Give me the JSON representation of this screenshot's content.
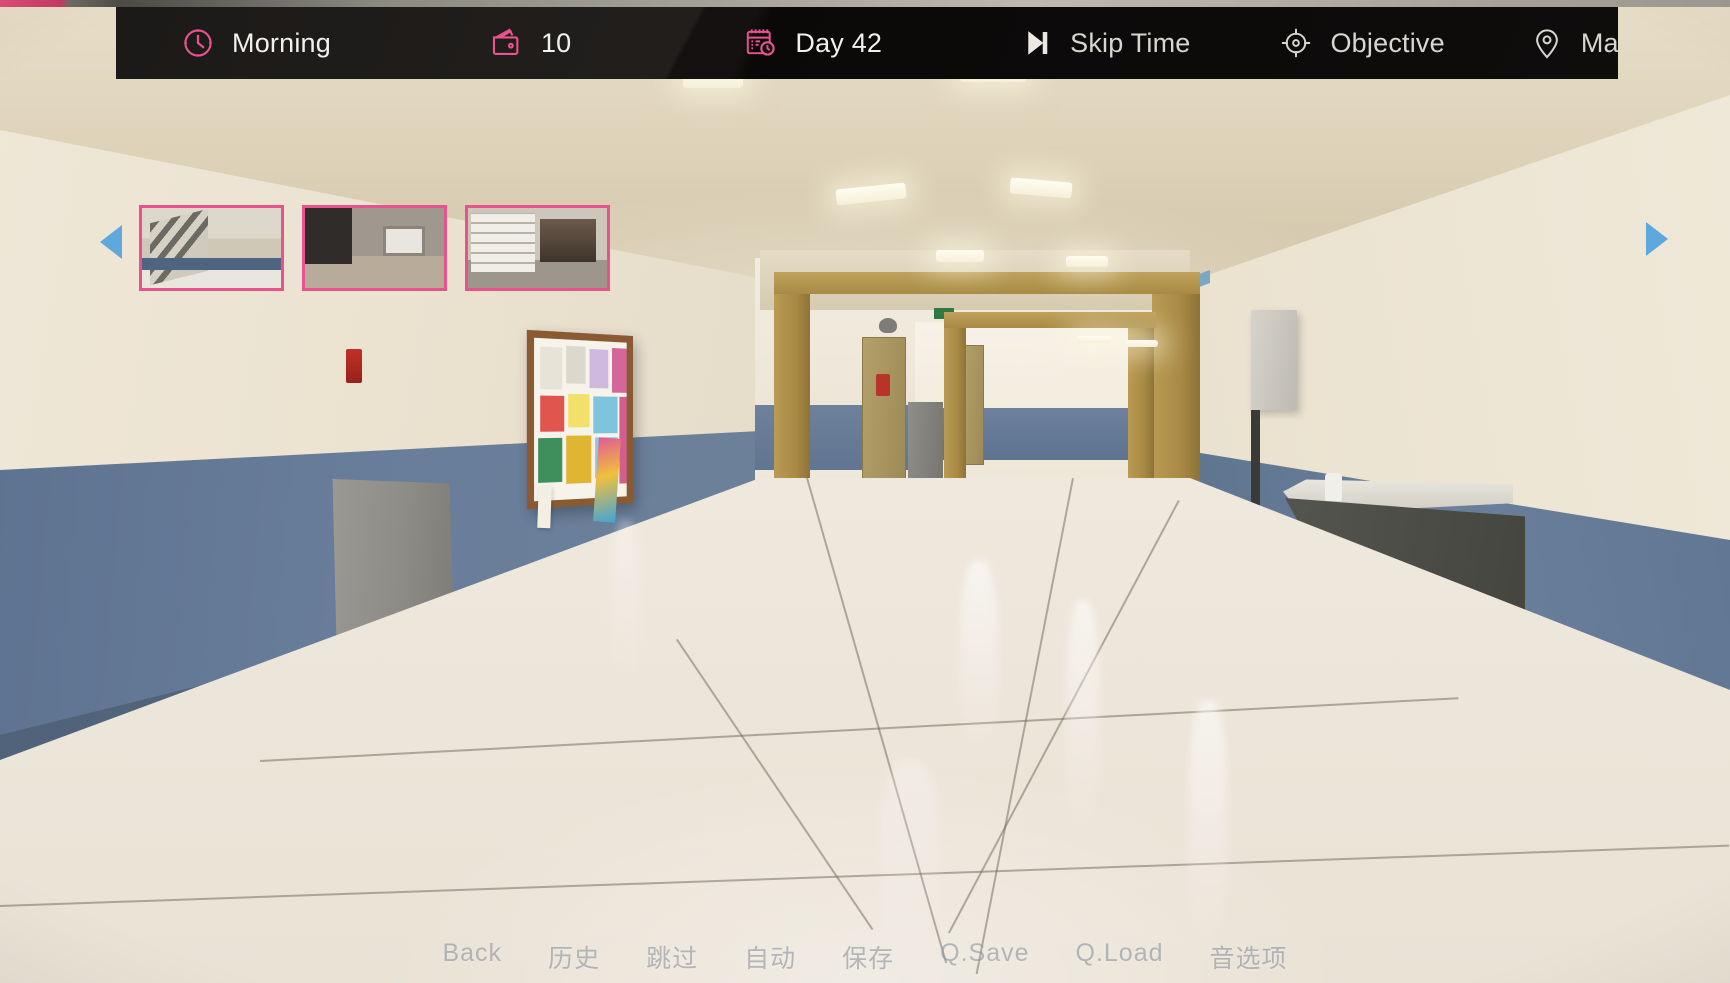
{
  "hud": {
    "time_of_day": {
      "icon": "clock-icon",
      "label": "Morning",
      "color": "#e8538e"
    },
    "money": {
      "icon": "wallet-icon",
      "label": "10",
      "color": "#e8538e"
    },
    "day": {
      "icon": "calendar-clock-icon",
      "label": "Day 42",
      "color": "#e8538e"
    },
    "skip_time": {
      "icon": "skip-forward-icon",
      "label": "Skip Time",
      "color": "#d9d6d1"
    },
    "objective": {
      "icon": "crosshair-icon",
      "label": "Objective",
      "color": "#d9d6d1"
    },
    "map": {
      "icon": "map-pin-icon",
      "label": "Map",
      "color": "#d9d6d1"
    }
  },
  "gallery": {
    "prev_arrow": "chevron-left-icon",
    "next_arrow": "chevron-right-icon",
    "border_color": "#e8538e",
    "arrow_color": "#5fa8dd",
    "thumbnails": [
      {
        "name": "school-lobby-stairs"
      },
      {
        "name": "dining-room"
      },
      {
        "name": "study-office"
      }
    ]
  },
  "bottom_menu": {
    "items": [
      {
        "label": "Back",
        "cjk": false
      },
      {
        "label": "历史",
        "cjk": true
      },
      {
        "label": "跳过",
        "cjk": true
      },
      {
        "label": "自动",
        "cjk": true
      },
      {
        "label": "保存",
        "cjk": true
      },
      {
        "label": "Q.Save",
        "cjk": false
      },
      {
        "label": "Q.Load",
        "cjk": false
      },
      {
        "label": "音选项",
        "cjk": true
      }
    ]
  },
  "scene": {
    "name": "school-hallway",
    "wall_upper_color": "#ece3d1",
    "wall_lower_color": "#63789a",
    "floor_color": "#ece5d8",
    "doorframe_color": "#a98a45"
  }
}
